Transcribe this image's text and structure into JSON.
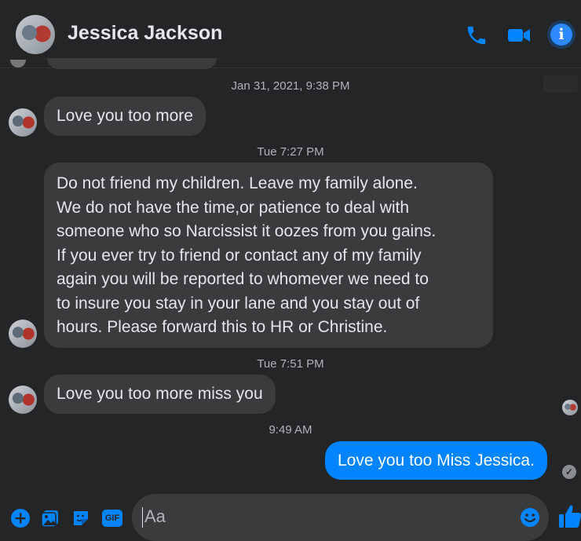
{
  "header": {
    "contact_name": "Jessica Jackson",
    "icons": [
      "phone-icon",
      "video-camera-icon",
      "info-icon"
    ],
    "info_symbol": "i",
    "accent": "#0084ff"
  },
  "messages": [
    {
      "type": "timestamp",
      "text": "Jan 31, 2021, 9:38 PM"
    },
    {
      "type": "incoming",
      "text": "Love you too more"
    },
    {
      "type": "timestamp",
      "text": "Tue 7:27 PM"
    },
    {
      "type": "incoming",
      "lines": [
        "Do not friend my children. Leave my family alone.",
        "We do not have the time,or patience to deal with",
        "someone who so Narcissist it oozes from you gains.",
        "If you ever try to friend or contact any of my family",
        "again you will be reported to whomever we need to",
        "to insure you stay in your lane and you stay out of",
        "hours. Please forward this to HR or Christine."
      ]
    },
    {
      "type": "timestamp",
      "text": "Tue 7:51 PM"
    },
    {
      "type": "incoming",
      "text": "Love you too more miss you"
    },
    {
      "type": "timestamp",
      "text": "9:49 AM"
    },
    {
      "type": "outgoing",
      "text": "Love you too Miss Jessica."
    }
  ],
  "composer": {
    "placeholder": "Aa",
    "gif_label": "GIF",
    "icons": [
      "add-icon",
      "photo-icon",
      "sticker-icon",
      "gif-icon",
      "emoji-icon",
      "like-icon"
    ]
  },
  "status": {
    "delivered_symbol": "✓"
  }
}
